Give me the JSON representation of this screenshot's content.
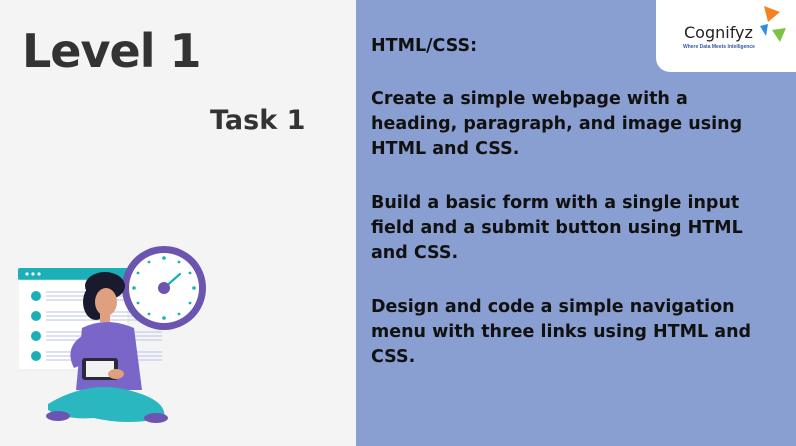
{
  "left": {
    "title": "Level 1",
    "task": "Task 1"
  },
  "right": {
    "heading": "HTML/CSS:",
    "tasks": [
      {
        "lines": [
          "Create a simple webpage with a",
          "heading, paragraph, and image using",
          "HTML and CSS."
        ]
      },
      {
        "lines": [
          "Build a basic form with a single input",
          "field and a submit button using HTML",
          "and CSS."
        ]
      },
      {
        "lines": [
          "Design and code a simple navigation",
          "menu with three links using HTML and",
          "CSS."
        ]
      }
    ]
  },
  "logo": {
    "name": "Cognifyz",
    "tagline": "Where Data Meets Intelligence"
  },
  "colors": {
    "right_panel_bg": "#8a9fd1",
    "left_panel_bg": "#f4f4f4",
    "clock_ring": "#6b55b0",
    "accent_teal": "#1bb0b8",
    "logo_orange": "#f58220",
    "logo_blue": "#2d8ee0",
    "logo_green": "#7dc242"
  },
  "icons": [
    "clock-icon",
    "checklist-icon",
    "person-illustration"
  ]
}
